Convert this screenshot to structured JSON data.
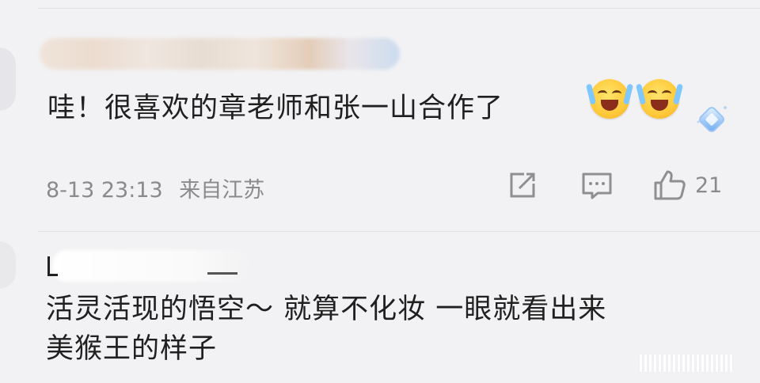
{
  "comments": [
    {
      "text": "哇！很喜欢的章老师和张一山合作了",
      "emojis": [
        "laugh-cry-emoji",
        "laugh-cry-emoji"
      ],
      "badge_icon": "diamond-badge-icon",
      "date": "8-13 23:13",
      "location": "来自江苏",
      "actions": {
        "share_icon": "share-icon",
        "comment_icon": "comment-icon",
        "like_icon": "thumbs-up-icon",
        "like_count": "21"
      }
    },
    {
      "name_visible": "[",
      "text_line_1": "活灵活现的悟空～ 就算不化妆 一眼就看出来",
      "text_line_2": "美猴王的样子"
    }
  ],
  "colors": {
    "background": "#f2f2f4",
    "text": "#202020",
    "meta": "#8a8a8a"
  }
}
